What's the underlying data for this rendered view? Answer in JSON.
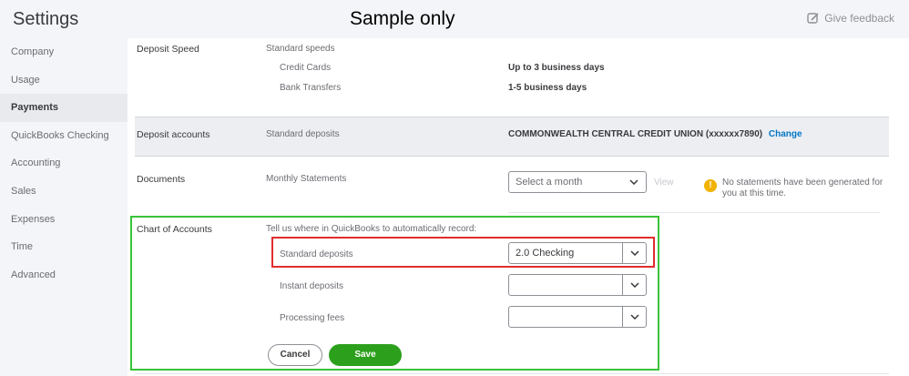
{
  "header": {
    "title": "Settings",
    "watermark": "Sample only",
    "feedback_label": "Give feedback",
    "feedback_icon": "edit-feedback-icon"
  },
  "sidebar": {
    "items": [
      {
        "label": "Company",
        "active": false
      },
      {
        "label": "Usage",
        "active": false
      },
      {
        "label": "Payments",
        "active": true
      },
      {
        "label": "QuickBooks Checking",
        "active": false
      },
      {
        "label": "Accounting",
        "active": false
      },
      {
        "label": "Sales",
        "active": false
      },
      {
        "label": "Expenses",
        "active": false
      },
      {
        "label": "Time",
        "active": false
      },
      {
        "label": "Advanced",
        "active": false
      }
    ]
  },
  "deposit_speed": {
    "title": "Deposit Speed",
    "speeds_label": "Standard speeds",
    "rows": [
      {
        "label": "Credit Cards",
        "value": "Up to 3 business days"
      },
      {
        "label": "Bank Transfers",
        "value": "1-5 business days"
      }
    ]
  },
  "deposit_accounts": {
    "title": "Deposit accounts",
    "label": "Standard deposits",
    "bank": "COMMONWEALTH CENTRAL CREDIT UNION (xxxxxx7890)",
    "change_label": "Change"
  },
  "documents": {
    "title": "Documents",
    "label": "Monthly Statements",
    "select_placeholder": "Select a month",
    "view_label": "View",
    "notice": "No statements have been generated for you at this time.",
    "notice_icon": "warning-icon"
  },
  "chart_of_accounts": {
    "title": "Chart of Accounts",
    "instruction": "Tell us where in QuickBooks to automatically record:",
    "fields": [
      {
        "label": "Standard deposits",
        "value": "2.0 Checking"
      },
      {
        "label": "Instant deposits",
        "value": ""
      },
      {
        "label": "Processing fees",
        "value": ""
      }
    ],
    "cancel_label": "Cancel",
    "save_label": "Save"
  },
  "colors": {
    "accent_green": "#2ca01c",
    "link_blue": "#0077c5",
    "highlight_green": "#39c339",
    "highlight_red": "#e02d2d",
    "warning": "#f2b200"
  }
}
